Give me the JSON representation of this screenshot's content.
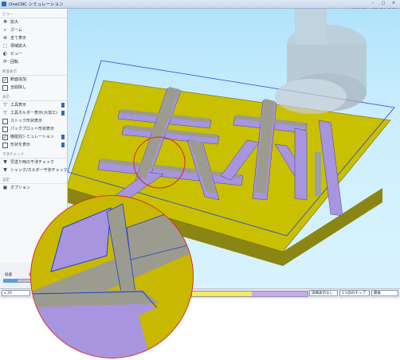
{
  "window": {
    "title": "OneCNC シミュレーション"
  },
  "coordinates": "X189.954, Y35.651, Z-7.5",
  "sidebar": {
    "sections": [
      {
        "heading": "ビュー",
        "items": [
          {
            "label": "拡大",
            "icon": "pan-icon"
          },
          {
            "label": "ズーム",
            "icon": "zoom-icon"
          },
          {
            "label": "全て表示",
            "icon": "fit-all-icon"
          },
          {
            "label": "領域拡大",
            "icon": "zoom-window-icon"
          },
          {
            "label": "ビュー",
            "icon": "view-icon"
          },
          {
            "label": "回転",
            "icon": "rotate-icon"
          }
        ]
      },
      {
        "heading": "断面表示",
        "items": [
          {
            "label": "断面追加",
            "checked": true
          },
          {
            "label": "全削除し"
          }
        ]
      },
      {
        "heading": "表示",
        "items": [
          {
            "label": "工具表示",
            "icon": "tool-icon"
          },
          {
            "label": "工具ホルダー表示(大加工)",
            "icon": "holder-icon"
          },
          {
            "label": "ストック形状表示",
            "checked": false
          },
          {
            "label": "パックプロット形状表示",
            "checked": false
          },
          {
            "label": "機能別シミュレーション",
            "checked": true
          },
          {
            "label": "形状を表示",
            "checked": false
          }
        ]
      },
      {
        "heading": "干渉チェック",
        "items": [
          {
            "label": "早送り時の干渉チェック",
            "icon": "interference-icon"
          },
          {
            "label": "シャンク/ホルダー干渉チェック",
            "icon": "shank-icon"
          }
        ]
      },
      {
        "heading": "設定",
        "items": [
          {
            "label": "オプション",
            "icon": "options-icon"
          }
        ]
      }
    ]
  },
  "speed": {
    "slow": "低速",
    "fast": "速"
  },
  "bottom": {
    "zoom": "x 20",
    "progress": 0.52,
    "dd1": "詳細表示なし",
    "dd2": "1つ前のチップ",
    "dd3": "最後"
  },
  "colors": {
    "stock": "#c8c000",
    "cut": "#a795df",
    "edge": "#1e3fc8",
    "highlight": "#e0222a"
  }
}
